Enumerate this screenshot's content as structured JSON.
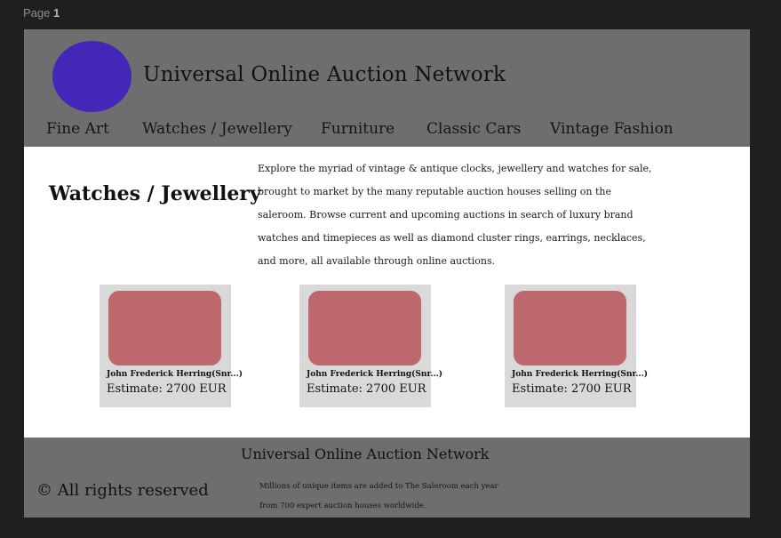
{
  "page_indicator": {
    "label": "Page",
    "number": "1"
  },
  "header": {
    "site_title": "Universal Online Auction Network",
    "logo_color": "#4327b8",
    "background_color": "#6e6e6e"
  },
  "nav": {
    "items": [
      {
        "label": "Fine Art"
      },
      {
        "label": "Watches / Jewellery"
      },
      {
        "label": "Furniture"
      },
      {
        "label": "Classic Cars"
      },
      {
        "label": "Vintage Fashion"
      }
    ]
  },
  "main": {
    "section_title": "Watches / Jewellery",
    "description": "Explore the myriad of vintage & antique clocks, jewellery and watches for sale, brought to market by the many reputable auction houses selling on the saleroom. Browse current and upcoming auctions in search of luxury brand watches and timepieces as well as diamond cluster rings, earrings, necklaces, and more, all available through online auctions.",
    "cards": [
      {
        "title": "John Frederick Herring(Snr...)",
        "estimate": "Estimate: 2700 EUR"
      },
      {
        "title": "John Frederick Herring(Snr...)",
        "estimate": "Estimate: 2700 EUR"
      },
      {
        "title": "John Frederick Herring(Snr...)",
        "estimate": "Estimate: 2700 EUR"
      }
    ],
    "card_image_color": "#bd686d"
  },
  "footer": {
    "title": "Universal Online Auction Network",
    "copyright": "© All rights reserved",
    "text": "Millions of unique items are added to The Saleroom each year from 700 expert auction houses worldwide."
  }
}
